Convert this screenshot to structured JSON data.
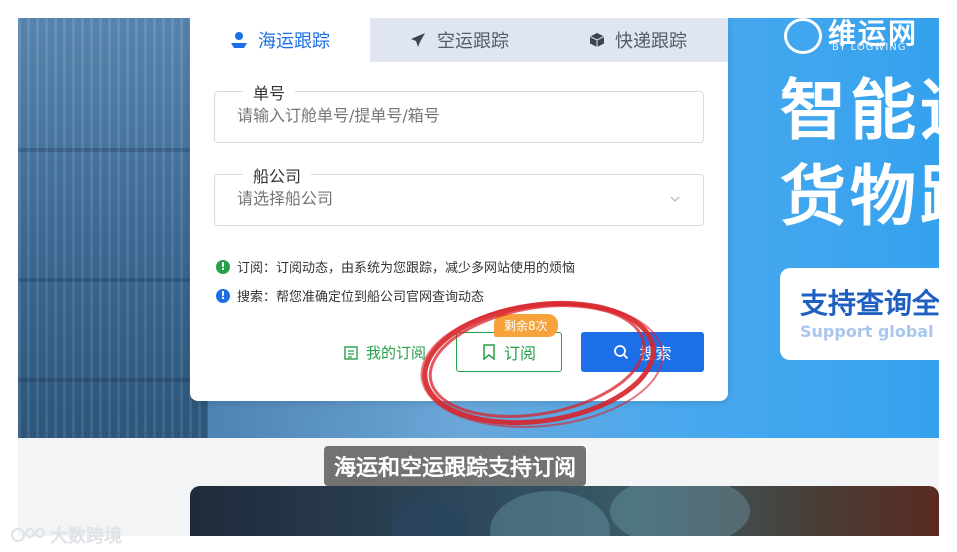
{
  "tabs": [
    {
      "label": "海运跟踪",
      "icon": "ship-icon",
      "active": true
    },
    {
      "label": "空运跟踪",
      "icon": "airplane-icon",
      "active": false
    },
    {
      "label": "快递跟踪",
      "icon": "package-icon",
      "active": false
    }
  ],
  "form": {
    "number_label": "单号",
    "number_placeholder": "请输入订舱单号/提单号/箱号",
    "carrier_label": "船公司",
    "carrier_placeholder": "请选择船公司"
  },
  "notes": {
    "subscribe": "订阅：订阅动态，由系统为您跟踪，减少多网站使用的烦恼",
    "search": "搜索：帮您准确定位到船公司官网查询动态"
  },
  "actions": {
    "my_subscriptions": "我的订阅",
    "subscribe": "订阅",
    "remaining": "剩余8次",
    "search": "搜索"
  },
  "brand": {
    "name": "维运网",
    "sub": "BY LOGWING"
  },
  "hero": {
    "line1": "智能追",
    "line2": "货物路",
    "support_title": "支持查询全",
    "support_sub": "Support global s"
  },
  "caption": "海运和空运跟踪支持订阅",
  "watermark": "大数跨境",
  "colors": {
    "primary": "#1d6fe8",
    "green": "#26a04a",
    "badge": "#f7a23a",
    "annotation": "#d8232a"
  }
}
